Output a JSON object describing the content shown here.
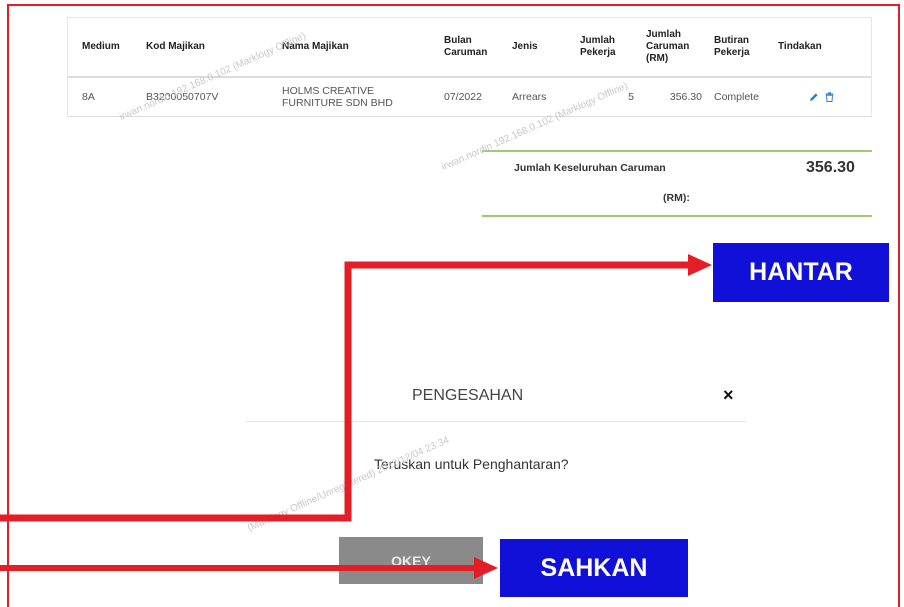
{
  "table": {
    "headers": [
      "Medium",
      "Kod Majikan",
      "Nama Majikan",
      "Bulan Caruman",
      "Jenis",
      "Jumlah Pekerja",
      "Jumlah Caruman (RM)",
      "Butiran Pekerja",
      "Tindakan"
    ],
    "rows": [
      {
        "medium": "8A",
        "kod_majikan": "B3200050707V",
        "nama_majikan": "HOLMS CREATIVE FURNITURE SDN BHD",
        "bulan_caruman": "07/2022",
        "jenis": "Arrears",
        "jumlah_pekerja": "5",
        "jumlah_caruman": "356.30",
        "butiran_pekerja": "Complete"
      }
    ]
  },
  "total": {
    "label": "Jumlah Keseluruhan Caruman",
    "unit": "(RM):",
    "value": "356.30"
  },
  "dialog": {
    "title": "PENGESAHAN",
    "close": "×",
    "message": "Teruskan untuk Penghantaran?",
    "ok_label": "OKEY"
  },
  "callouts": {
    "hantar": "HANTAR",
    "sahkan": "SAHKAN"
  },
  "colors": {
    "frame": "#e41e26",
    "callout_bg": "#1010d8",
    "total_rule": "#9ccb76",
    "ok_button": "#8a8a8a",
    "action_icon": "#2f7fd0"
  },
  "icons": {
    "edit": "pencil-icon",
    "delete": "trash-icon",
    "close": "close-icon"
  }
}
